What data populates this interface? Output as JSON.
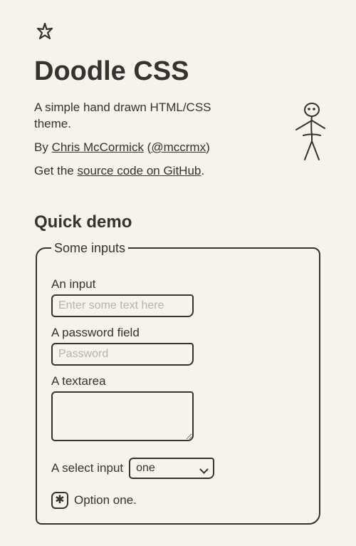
{
  "header": {
    "title": "Doodle CSS"
  },
  "intro": {
    "tagline": "A simple hand drawn HTML/CSS theme.",
    "by_prefix": "By ",
    "author_name": "Chris McCormick",
    "paren_open": " (",
    "author_handle": "@mccrmx",
    "paren_close": ")",
    "source_prefix": "Get the ",
    "source_link": "source code on GitHub",
    "period": "."
  },
  "demo": {
    "heading": "Quick demo",
    "fieldset_legend": "Some inputs",
    "text_input": {
      "label": "An input",
      "placeholder": "Enter some text here"
    },
    "password_input": {
      "label": "A password field",
      "placeholder": "Password"
    },
    "textarea": {
      "label": "A textarea"
    },
    "select": {
      "label": "A select input",
      "selected": "one"
    },
    "checkbox1": {
      "label": "Option one.",
      "mark": "✱"
    }
  }
}
